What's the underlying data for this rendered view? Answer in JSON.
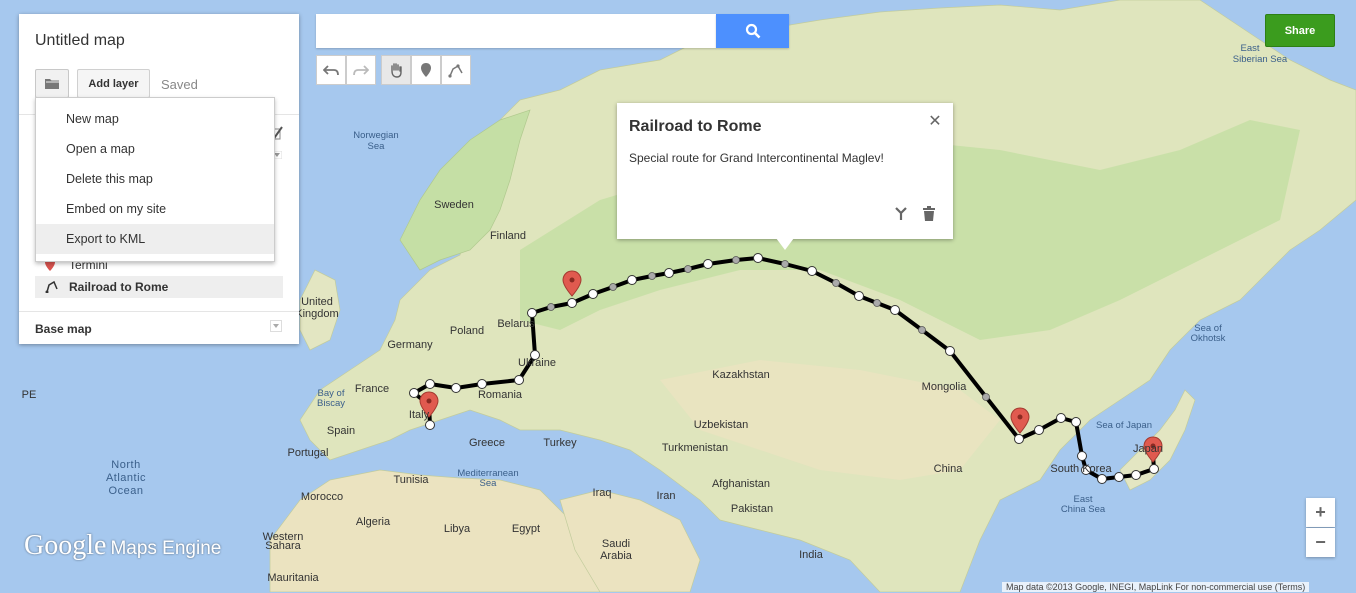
{
  "panel": {
    "map_title": "Untitled map",
    "add_layer_label": "Add layer",
    "saved_status": "Saved",
    "places": [
      {
        "label": "Termini"
      },
      {
        "label": "Railroad to Rome"
      }
    ],
    "base_map_label": "Base map"
  },
  "file_menu": {
    "items": [
      {
        "label": "New map"
      },
      {
        "label": "Open a map"
      },
      {
        "label": "Delete this map"
      },
      {
        "label": "Embed on my site"
      },
      {
        "label": "Export to KML"
      }
    ]
  },
  "search": {
    "value": "",
    "placeholder": ""
  },
  "toolbar": {
    "tools": [
      "undo-icon",
      "redo-icon",
      "hand-icon",
      "add-marker-icon",
      "draw-line-icon"
    ]
  },
  "share_label": "Share",
  "info_popup": {
    "title": "Railroad to Rome",
    "description": "Special route for Grand Intercontinental Maglev!"
  },
  "zoom": {
    "in_label": "+",
    "out_label": "−"
  },
  "logo": {
    "google": "Google",
    "product": "Maps Engine"
  },
  "attribution": "Map data ©2013 Google, INEGI, MapLink     For non-commercial use (Terms)",
  "map_labels": {
    "east_siberian_sea": [
      "East",
      "Siberian Sea"
    ],
    "norwegian_sea": [
      "Norwegian",
      "Sea"
    ],
    "sweden": "Sweden",
    "finland": "Finland",
    "united_kingdom": [
      "United",
      "Kingdom"
    ],
    "belarus": "Belarus",
    "poland": "Poland",
    "germany": "Germany",
    "ukraine": "Ukraine",
    "france": "France",
    "romania": "Romania",
    "bay_of_biscay": [
      "Bay of",
      "Biscay"
    ],
    "spain": "Spain",
    "italy": "Italy",
    "portugal": "Portugal",
    "greece": "Greece",
    "turkey": "Turkey",
    "kazakhstan": "Kazakhstan",
    "uzbekistan": "Uzbekistan",
    "turkmenistan": "Turkmenistan",
    "mongolia": "Mongolia",
    "china": "China",
    "sea_of_okhotsk": [
      "Sea of",
      "Okhotsk"
    ],
    "sea_of_japan": "Sea of Japan",
    "japan": "Japan",
    "south_korea": "South Korea",
    "east_china_sea": [
      "East",
      "China Sea"
    ],
    "north_atlantic_ocean": [
      "North",
      "Atlantic",
      "Ocean"
    ],
    "morocco": "Morocco",
    "tunisia": "Tunisia",
    "mediterranean_sea": [
      "Mediterranean",
      "Sea"
    ],
    "algeria": "Algeria",
    "libya": "Libya",
    "egypt": "Egypt",
    "iraq": "Iraq",
    "iran": "Iran",
    "afghanistan": "Afghanistan",
    "pakistan": "Pakistan",
    "saudi_arabia": [
      "Saudi",
      "Arabia"
    ],
    "india": "India",
    "western_sahara": [
      "Western",
      "Sahara"
    ],
    "mauritania": "Mauritania",
    "pe": "PE"
  },
  "colors": {
    "water": "#a6c8ee",
    "land": "#e3e6c2",
    "forest": "#c5dfa5",
    "desert": "#ebe3c0",
    "route": "#000000",
    "marker": "#e05a4f",
    "share": "#3b9c1e",
    "search_button": "#4d90fe"
  }
}
